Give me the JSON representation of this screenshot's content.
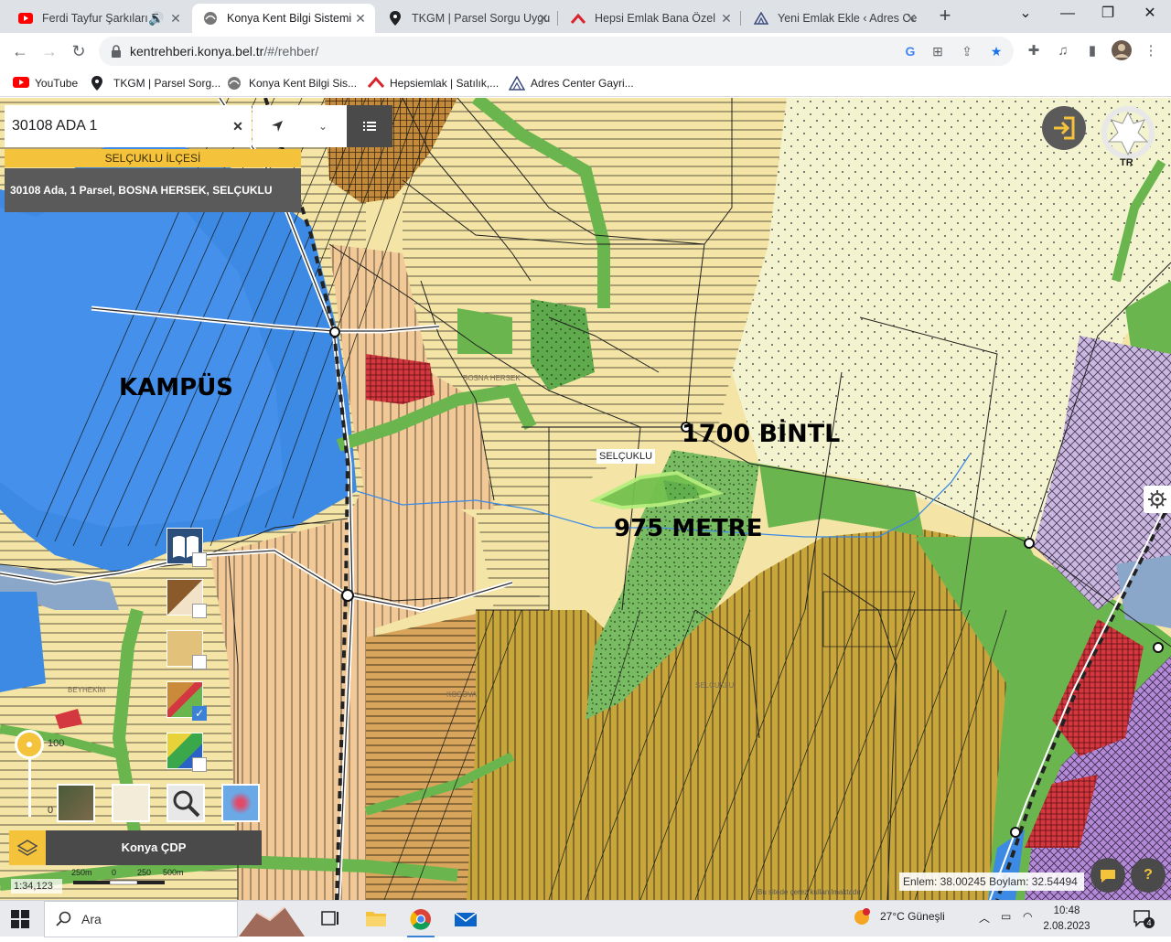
{
  "browser": {
    "tabs": [
      {
        "title": "Ferdi Tayfur Şarkıları E",
        "icon": "youtube-icon"
      },
      {
        "title": "Konya Kent Bilgi Sistemi",
        "icon": "kbs-icon"
      },
      {
        "title": "TKGM | Parsel Sorgu Uygu",
        "icon": "map-pin-icon"
      },
      {
        "title": "Hepsi Emlak Bana Özel",
        "icon": "hepsiemlak-icon"
      },
      {
        "title": "Yeni Emlak Ekle ‹ Adres Ce",
        "icon": "adres-center-icon"
      }
    ],
    "url_host": "kentrehberi.konya.bel.tr",
    "url_path": "/#/rehber/",
    "bookmarks": [
      {
        "label": "YouTube",
        "icon": "youtube-icon"
      },
      {
        "label": "TKGM | Parsel Sorg...",
        "icon": "map-pin-icon"
      },
      {
        "label": "Konya Kent Bilgi Sis...",
        "icon": "kbs-icon"
      },
      {
        "label": "Hepsiemlak | Satılık,...",
        "icon": "hepsiemlak-icon"
      },
      {
        "label": "Adres Center Gayri...",
        "icon": "adres-center-icon"
      }
    ]
  },
  "search": {
    "value": "30108 ADA 1",
    "district": "SELÇUKLU İLÇESİ",
    "result": "30108 Ada, 1 Parsel, BOSNA HERSEK, SELÇUKLU"
  },
  "map": {
    "annotations": {
      "campus": "KAMPÜS",
      "road_width": "1700 BİNTL",
      "distance": "975 METRE",
      "parcel_label": "SELÇUKLU"
    },
    "small_labels": {
      "bosna": "BOSNA HERSEK",
      "kosova": "KOSOVA",
      "selcuklu": "SELÇUKLU",
      "beyhekim": "BEYHEKİM",
      "emblem_tr": "TR"
    },
    "colors": {
      "residential_yellow": "#f4e5a6",
      "residential_orange": "#f1c896",
      "green_area": "#6bb54e",
      "campus_blue": "#3d8ae5",
      "industrial_olive": "#c9a63c",
      "purple_zone": "#b48ad8",
      "red_zone": "#d3373f"
    }
  },
  "controls": {
    "opacity_value": "100",
    "opacity_min": "0",
    "plan_name": "Konya ÇDP",
    "scale_ratio": "1:34,123",
    "scale_ticks": [
      "250m",
      "0",
      "250",
      "500m"
    ],
    "coordinates": "Enlem: 38.00245 Boylam: 32.54494",
    "footnote": "Bu sitede çerez kullanılmaktadır",
    "layers": [
      {
        "name": "plan-notes",
        "checked": false
      },
      {
        "name": "parcels",
        "checked": false
      },
      {
        "name": "zoning",
        "checked": false
      },
      {
        "name": "master-plan",
        "checked": true
      },
      {
        "name": "land-use",
        "checked": false
      }
    ]
  },
  "taskbar": {
    "search_label": "Ara",
    "weather": "27°C  Güneşli",
    "time": "10:48",
    "date": "2.08.2023",
    "notifications": "4"
  }
}
